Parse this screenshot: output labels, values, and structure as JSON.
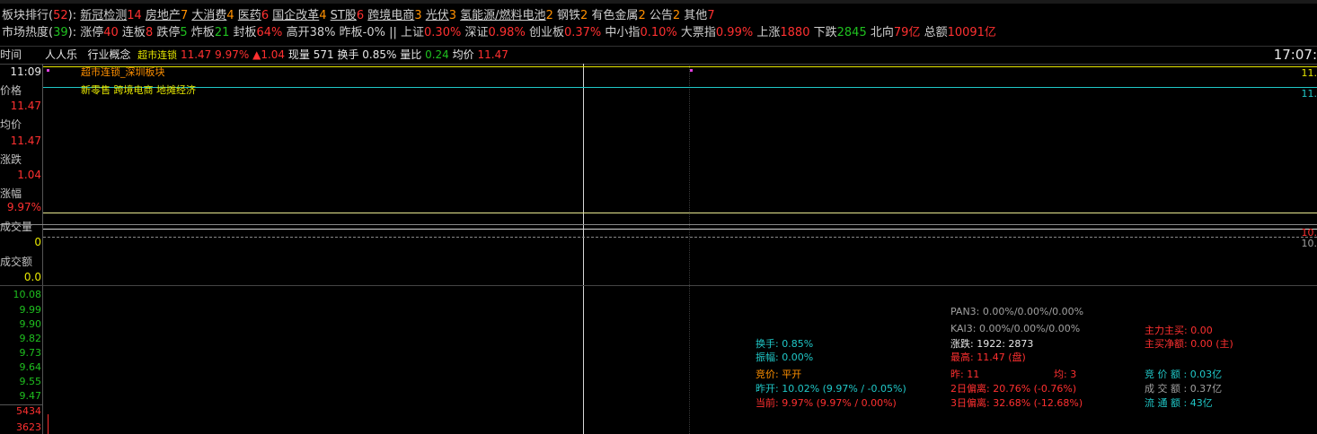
{
  "top_row1": {
    "label": "板块排行(",
    "count": "52",
    "close": "):",
    "items": [
      {
        "name": "新冠检测",
        "num": "14"
      },
      {
        "name": "房地产",
        "num": "7"
      },
      {
        "name": "大消费",
        "num": "4"
      },
      {
        "name": "医药",
        "num": "6"
      },
      {
        "name": "国企改革",
        "num": "4"
      },
      {
        "name": "ST股",
        "num": "6"
      },
      {
        "name": "跨境电商",
        "num": "3"
      },
      {
        "name": "光伏",
        "num": "3"
      },
      {
        "name": "氢能源/燃料电池",
        "num": "2"
      },
      {
        "name": "钢铁",
        "num": "2"
      },
      {
        "name": "有色金属",
        "num": "2"
      },
      {
        "name": "公告",
        "num": "2"
      },
      {
        "name": "其他",
        "num": "7"
      }
    ]
  },
  "top_row2": {
    "label": "市场热度(",
    "count": "39",
    "close": "):",
    "zt_l": "涨停",
    "zt": "40",
    "lb_l": "连板",
    "lb": "8",
    "dt_l": "跌停",
    "dt": "5",
    "zb_l": "炸板",
    "zb": "21",
    "fb_l": "封板",
    "fb": "64%",
    "gk_l": "高开",
    "gk": "38%",
    "zrb_l": "昨板",
    "zrb": "-0%",
    "sep": "||",
    "sz_l": "上证",
    "sz": "0.30%",
    "szz_l": "深证",
    "szz": "0.98%",
    "cyb_l": "创业板",
    "cyb": "0.37%",
    "zxb_l": "中小指",
    "zxb": "0.10%",
    "dpz_l": "大票指",
    "dpz": "0.99%",
    "sz2_l": "上涨",
    "up": "1880",
    "xd_l": "下跌",
    "down": "2845",
    "bx_l": "北向",
    "bx": "79亿",
    "ze_l": "总额",
    "ze": "10091亿"
  },
  "header3": {
    "time_label": "时间",
    "stock": "人人乐",
    "concept_label": "行业概念",
    "concept": "超市连锁",
    "price": "11.47",
    "pct": "9.97%",
    "chg": "▲1.04",
    "vol_label": "现量",
    "vol": "571",
    "turn_label": "换手",
    "turn": "0.85%",
    "lb_label": "量比",
    "lb": "0.24",
    "avg_label": "均价",
    "avg": "11.47",
    "clock": "17:07:"
  },
  "left_panel": {
    "time": "11:09",
    "price_label": "价格",
    "price": "11.47",
    "avg_label": "均价",
    "avg": "11.47",
    "chg_label": "涨跌",
    "chg": "1.04",
    "pct_label": "涨幅",
    "pct": "9.97%",
    "vol_label": "成交量",
    "vol": "0",
    "amt_label": "成交额",
    "amt": "0.0"
  },
  "chart_tags": {
    "tag1": "超市连锁_深圳板块",
    "tag2": "新零售 跨境电商 地摊经济"
  },
  "right_edge": {
    "r1": "11.",
    "r2": "11.",
    "r3": "10.",
    "r4": "10."
  },
  "y_axis": [
    "10.08",
    "9.99",
    "9.90",
    "9.82",
    "9.73",
    "9.64",
    "9.55",
    "9.47"
  ],
  "vol_axis": [
    "5434",
    "3623"
  ],
  "stats": {
    "pan3": "PAN3: 0.00%/0.00%/0.00%",
    "kai3": "KAI3: 0.00%/0.00%/0.00%",
    "zlzm": "主力主买: 0.00",
    "zmje": "主买净额: 0.00 (主)",
    "hs": "换手: 0.85%",
    "zf": "振幅: 0.00%",
    "zd": "涨跌: 1922: 2873",
    "zg": "最高: 11.47 (盘)",
    "jj": "竞价: 平开",
    "zuo": "昨: 11",
    "jun": "均: 3",
    "jjje": "竞 价 额 : 0.03亿",
    "zk": "昨开: 10.02% (9.97% / -0.05%)",
    "pl2": "2日偏离: 20.76% (-0.76%)",
    "cje": "成 交 额 : 0.37亿",
    "dq": "当前: 9.97% (9.97% / 0.00%)",
    "pl3": "3日偏离: 32.68% (-12.68%)",
    "ltsz": "流 通 额 : 43亿"
  }
}
